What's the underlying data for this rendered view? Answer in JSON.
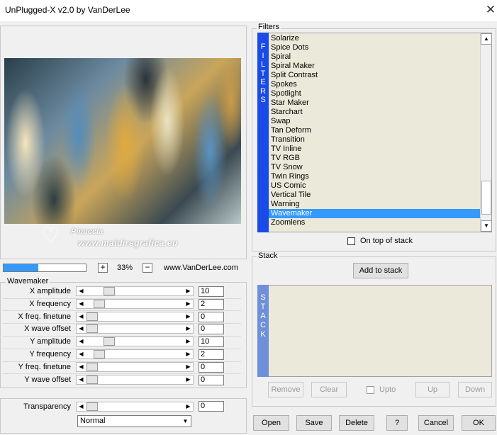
{
  "window": {
    "title": "UnPlugged-X v2.0 by VanDerLee",
    "close_glyph": "✕"
  },
  "preview": {
    "watermark_heart": "♡",
    "watermark_name": "Pinuccia",
    "watermark_url": "www.maidiregrafica.eu",
    "progress_fraction": 0.42,
    "zoom_plus": "+",
    "zoom_minus": "−",
    "zoom": "33%",
    "website": "www.VanDerLee.com"
  },
  "wavemaker": {
    "title": "Wavemaker",
    "arrow_left": "◀",
    "arrow_right": "▶",
    "params": [
      {
        "label": "X amplitude",
        "value": "10"
      },
      {
        "label": "X frequency",
        "value": "2"
      },
      {
        "label": "X freq. finetune",
        "value": "0"
      },
      {
        "label": "X wave offset",
        "value": "0"
      },
      {
        "label": "Y amplitude",
        "value": "10"
      },
      {
        "label": "Y frequency",
        "value": "2"
      },
      {
        "label": "Y freq. finetune",
        "value": "0"
      },
      {
        "label": "Y wave offset",
        "value": "0"
      }
    ],
    "transparency_label": "Transparency",
    "transparency_value": "0",
    "blend_mode": "Normal",
    "select_arrow": "▼"
  },
  "filters": {
    "title": "Filters",
    "band_letters": [
      "F",
      "I",
      "L",
      "T",
      "E",
      "R",
      "S"
    ],
    "items": [
      "Solarize",
      "Spice Dots",
      "Spiral",
      "Spiral Maker",
      "Split Contrast",
      "Spokes",
      "Spotlight",
      "Star Maker",
      "Starchart",
      "Swap",
      "Tan Deform",
      "Transition",
      "TV Inline",
      "TV RGB",
      "TV Snow",
      "Twin Rings",
      "US Comic",
      "Vertical Tile",
      "Warning",
      "Wavemaker",
      "Zoomlens"
    ],
    "selected": "Wavemaker",
    "scroll_up": "▲",
    "scroll_down": "▼",
    "on_top_label": "On top of stack"
  },
  "stack": {
    "title": "Stack",
    "band_letters": [
      "S",
      "T",
      "A",
      "C",
      "K"
    ],
    "add_label": "Add to stack",
    "remove_label": "Remove",
    "clear_label": "Clear",
    "upto_label": "Upto",
    "up_label": "Up",
    "down_label": "Down"
  },
  "footer": {
    "open": "Open",
    "save": "Save",
    "delete": "Delete",
    "help": "?",
    "cancel": "Cancel",
    "ok": "OK"
  }
}
